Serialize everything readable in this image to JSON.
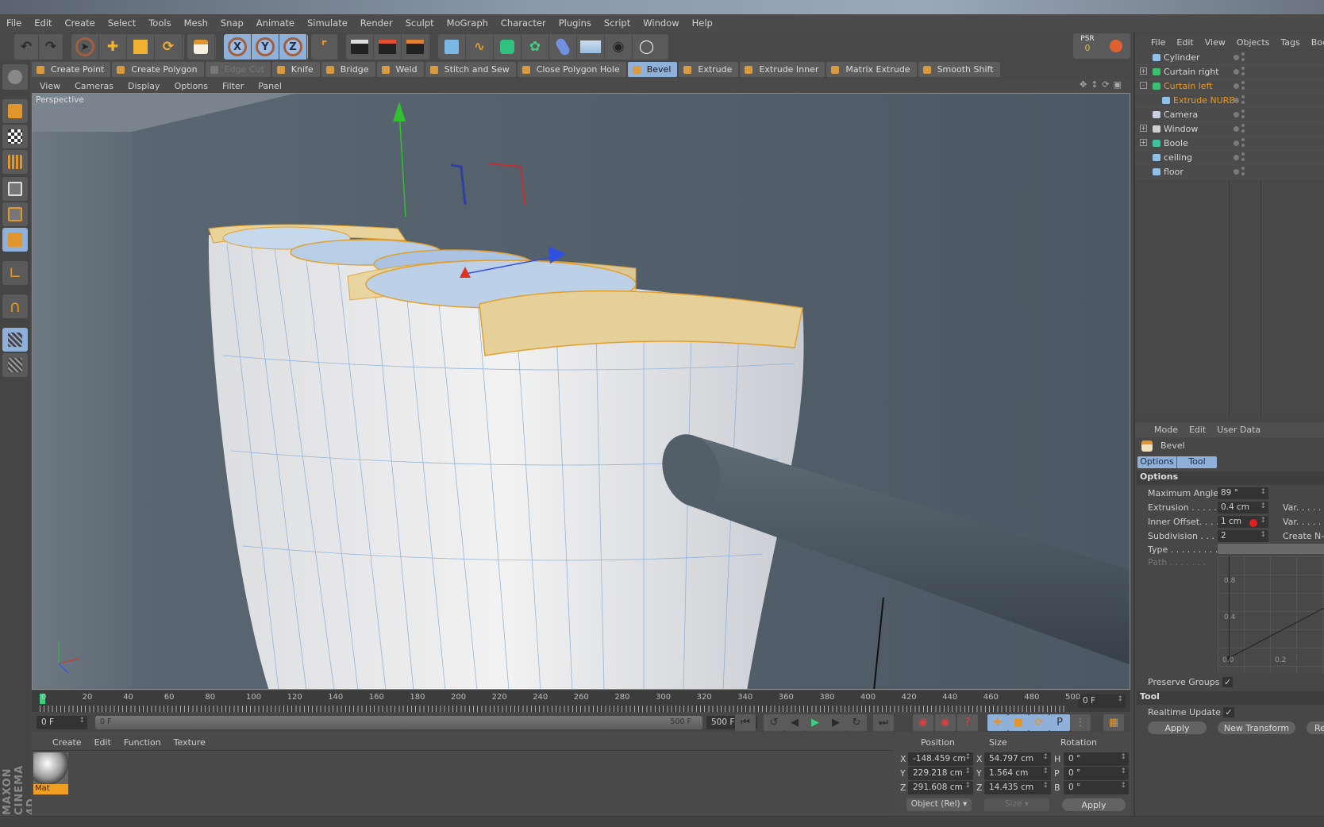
{
  "app": {
    "brand": "MAXON CINEMA 4D"
  },
  "menubar": [
    "File",
    "Edit",
    "Create",
    "Select",
    "Tools",
    "Mesh",
    "Snap",
    "Animate",
    "Simulate",
    "Render",
    "Sculpt",
    "MoGraph",
    "Character",
    "Plugins",
    "Script",
    "Window",
    "Help"
  ],
  "axis_buttons": [
    "X",
    "Y",
    "Z"
  ],
  "psr": {
    "label": "PSR",
    "value": "0"
  },
  "mesh_tools": [
    {
      "label": "Create Point",
      "state": "normal"
    },
    {
      "label": "Create Polygon",
      "state": "normal"
    },
    {
      "label": "Edge Cut",
      "state": "disabled"
    },
    {
      "label": "Knife",
      "state": "normal"
    },
    {
      "label": "Bridge",
      "state": "normal"
    },
    {
      "label": "Weld",
      "state": "normal"
    },
    {
      "label": "Stitch and Sew",
      "state": "normal"
    },
    {
      "label": "Close Polygon Hole",
      "state": "normal"
    },
    {
      "label": "Bevel",
      "state": "active"
    },
    {
      "label": "Extrude",
      "state": "normal"
    },
    {
      "label": "Extrude Inner",
      "state": "normal"
    },
    {
      "label": "Matrix Extrude",
      "state": "normal"
    },
    {
      "label": "Smooth Shift",
      "state": "normal"
    }
  ],
  "viewport": {
    "menu": [
      "View",
      "Cameras",
      "Display",
      "Options",
      "Filter",
      "Panel"
    ],
    "label": "Perspective"
  },
  "timeline": {
    "ticks": [
      "0",
      "20",
      "40",
      "60",
      "80",
      "100",
      "120",
      "140",
      "160",
      "180",
      "200",
      "220",
      "240",
      "260",
      "280",
      "300",
      "320",
      "340",
      "360",
      "380",
      "400",
      "420",
      "440",
      "460",
      "480",
      "500"
    ],
    "current_frame": "0 F",
    "start": "0 F",
    "range_start": "0 F",
    "range_end": "500 F",
    "end": "500 F"
  },
  "material_manager": {
    "menu": [
      "Create",
      "Edit",
      "Function",
      "Texture"
    ],
    "materials": [
      {
        "name": "Mat"
      }
    ]
  },
  "coordinates": {
    "headers": [
      "Position",
      "Size",
      "Rotation"
    ],
    "rows": [
      {
        "axis": "X",
        "position": "-148.459 cm",
        "size_axis": "X",
        "size": "54.797 cm",
        "rot_axis": "H",
        "rotation": "0 °"
      },
      {
        "axis": "Y",
        "position": "229.218 cm",
        "size_axis": "Y",
        "size": "1.564 cm",
        "rot_axis": "P",
        "rotation": "0 °"
      },
      {
        "axis": "Z",
        "position": "291.608 cm",
        "size_axis": "Z",
        "size": "14.435 cm",
        "rot_axis": "B",
        "rotation": "0 °"
      }
    ],
    "mode": "Object (Rel)",
    "size_mode": "Size",
    "apply": "Apply"
  },
  "object_manager": {
    "menu": [
      "File",
      "Edit",
      "View",
      "Objects",
      "Tags",
      "Boo"
    ],
    "objects": [
      {
        "name": "Cylinder",
        "depth": 0,
        "expand": "",
        "selected": false,
        "icon_color": "#8fc0e8"
      },
      {
        "name": "Curtain right",
        "depth": 0,
        "expand": "+",
        "selected": false,
        "icon_color": "#3cc070"
      },
      {
        "name": "Curtain left",
        "depth": 0,
        "expand": "-",
        "selected": true,
        "icon_color": "#3cc070"
      },
      {
        "name": "Extrude NURB",
        "depth": 1,
        "expand": "",
        "selected": true,
        "icon_color": "#8fc0e8"
      },
      {
        "name": "Camera",
        "depth": 0,
        "expand": "",
        "selected": false,
        "icon_color": "#c8d0e0"
      },
      {
        "name": "Window",
        "depth": 0,
        "expand": "+",
        "selected": false,
        "icon_color": "#d0d0d0"
      },
      {
        "name": "Boole",
        "depth": 0,
        "expand": "+",
        "selected": false,
        "icon_color": "#40c0a0"
      },
      {
        "name": "ceiling",
        "depth": 0,
        "expand": "",
        "selected": false,
        "icon_color": "#8fc0e8"
      },
      {
        "name": "floor",
        "depth": 0,
        "expand": "",
        "selected": false,
        "icon_color": "#8fc0e8"
      }
    ]
  },
  "attributes": {
    "menu": [
      "Mode",
      "Edit",
      "User Data"
    ],
    "tool_name": "Bevel",
    "tabs": [
      "Options",
      "Tool"
    ],
    "options_header": "Options",
    "fields": [
      {
        "label": "Maximum Angle",
        "value": "89 °"
      },
      {
        "label": "Extrusion . . . . . .",
        "value": "0.4 cm",
        "extra": "Var. . . . . ."
      },
      {
        "label": "Inner Offset. . . .",
        "value": "1 cm",
        "extra": "Var. . . . . ."
      },
      {
        "label": "Subdivision . . . .",
        "value": "2",
        "extra": "Create N-g"
      }
    ],
    "type_label": "Type . . . . . . . . . .",
    "path_label": "Path . . . . . . .",
    "graph": {
      "y_ticks": [
        "0.8",
        "0.4"
      ],
      "x_ticks": [
        "0.0",
        "0.2"
      ]
    },
    "preserve_groups": {
      "label": "Preserve Groups",
      "checked": true
    },
    "tool_header": "Tool",
    "realtime_update": {
      "label": "Realtime Update",
      "checked": true
    },
    "buttons": [
      "Apply",
      "New Transform",
      "Re"
    ]
  },
  "colors": {
    "accent_selection": "#e59a2a",
    "active_blue": "#8fb0d8",
    "background": "#4a4a4a"
  }
}
